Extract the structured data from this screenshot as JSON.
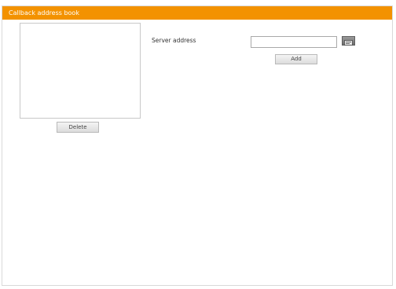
{
  "window": {
    "title": "Callback address book"
  },
  "address_list": {
    "items": []
  },
  "buttons": {
    "delete_label": "Delete",
    "add_label": "Add"
  },
  "server": {
    "label": "Server address",
    "value": "",
    "browse_icon": "address-book-icon"
  },
  "colors": {
    "titlebar": "#f39200"
  }
}
